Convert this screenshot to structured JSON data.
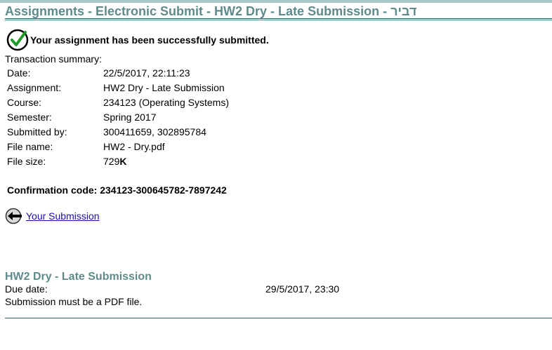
{
  "header": {
    "title": "Assignments - Electronic Submit - HW2 Dry - Late Submission - דביר"
  },
  "status": {
    "message": "Your assignment has been successfully submitted.",
    "icon": "check-circle-icon"
  },
  "summary": {
    "heading": "Transaction summary:",
    "rows": [
      {
        "label": "Date:",
        "value": "22/5/2017, 22:11:23"
      },
      {
        "label": "Assignment:",
        "value": "HW2 Dry - Late Submission"
      },
      {
        "label": "Course:",
        "value": "234123 (Operating Systems)"
      },
      {
        "label": "Semester:",
        "value": "Spring 2017"
      },
      {
        "label": "Submitted by:",
        "value": "300411659, 302895784"
      },
      {
        "label": "File name:",
        "value": "HW2 - Dry.pdf"
      },
      {
        "label": "File size:",
        "value_num": "729",
        "value_unit": "K"
      }
    ],
    "confirmation": "Confirmation code: 234123-300645782-7897242"
  },
  "navigation": {
    "back_link": "Your Submission",
    "icon": "back-arrow-icon"
  },
  "assignment_info": {
    "title": "HW2 Dry - Late Submission",
    "due_label": "Due date:",
    "due_value": "29/5/2017, 23:30",
    "note": "Submission must be a PDF file."
  },
  "colors": {
    "title": "#5f8a8b",
    "rule": "#2f5f6f",
    "link": "#1a0dab"
  }
}
